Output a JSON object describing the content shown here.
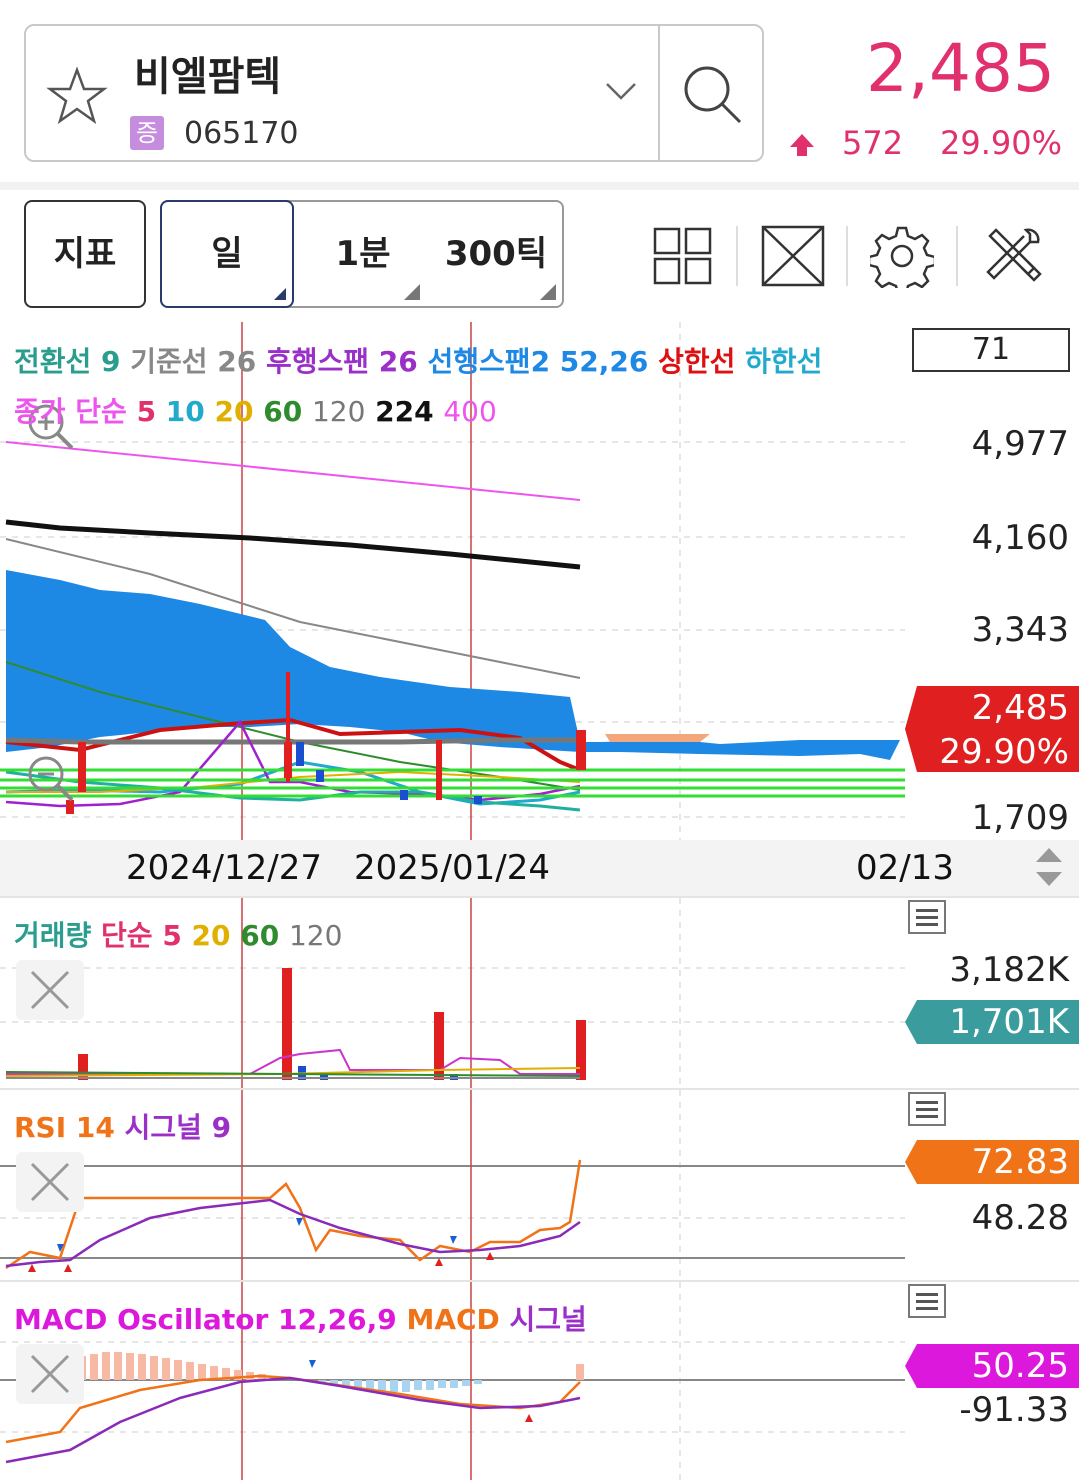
{
  "header": {
    "stock_name": "비엘팜텍",
    "market_badge": "증",
    "stock_code": "065170",
    "price": "2,485",
    "change": "572",
    "change_pct": "29.90%"
  },
  "toolbar": {
    "indicator_label": "지표",
    "period_day": "일",
    "period_1min": "1분",
    "period_300tick": "300틱"
  },
  "main_chart": {
    "legend_line1": {
      "conv": "전환선 9",
      "base": "기준선 26",
      "lag": "후행스팬 26",
      "lead": "선행스팬2 52,26",
      "upper": "상한선",
      "lower": "하한선"
    },
    "legend_line2": {
      "close": "종가",
      "simple": "단순",
      "ma5": "5",
      "ma10": "10",
      "ma20": "20",
      "ma60": "60",
      "ma120": "120",
      "ma224": "224",
      "ma400": "400"
    },
    "count_box": "71",
    "y_labels": [
      "4,977",
      "4,160",
      "3,343",
      "1,709"
    ],
    "price_tag": "2,485",
    "price_tag_pct": "29.90%"
  },
  "dates": [
    "2024/12/27",
    "2025/01/24",
    "02/13"
  ],
  "volume": {
    "legend": {
      "name": "거래량",
      "simple": "단순",
      "ma5": "5",
      "ma20": "20",
      "ma60": "60",
      "ma120": "120"
    },
    "y_label": "3,182K",
    "tag": "1,701K"
  },
  "rsi": {
    "legend": {
      "name": "RSI 14",
      "signal": "시그널 9"
    },
    "tag": "72.83",
    "y_label": "48.28"
  },
  "macd": {
    "legend": {
      "osc": "MACD Oscillator 12,26,9",
      "macd": "MACD",
      "signal": "시그널"
    },
    "tag": "50.25",
    "y_label": "-91.33"
  },
  "colors": {
    "rise": "#e0306e",
    "price_tag": "#e02020",
    "volume_tag": "#3a9c9c",
    "rsi_tag": "#f07318",
    "macd_tag": "#dd18dd",
    "cloud": "#1e88e5"
  }
}
